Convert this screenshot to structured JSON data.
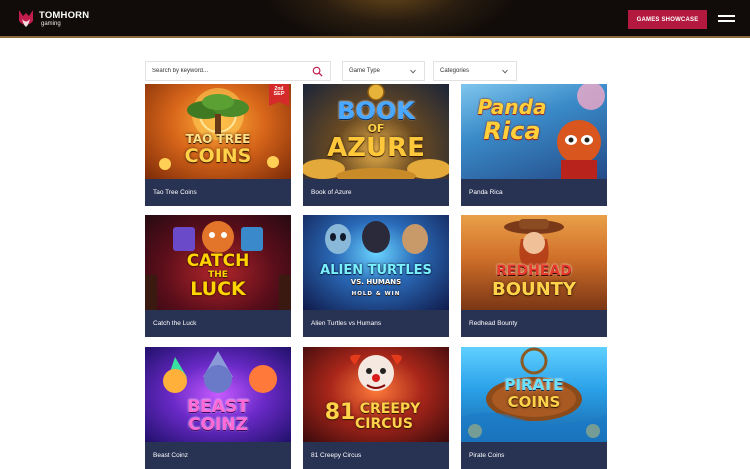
{
  "header": {
    "logo_title": "TOMHORN",
    "logo_sub": "gaming",
    "showcase_button": "GAMES SHOWCASE"
  },
  "filters": {
    "search_placeholder": "Search by keyword...",
    "game_type": "Game Type",
    "categories": "Categories"
  },
  "games": [
    {
      "name": "Tao Tree Coins",
      "art_line1": "TAO TREE",
      "art_line2": "COINS",
      "badge_day": "2nd",
      "badge_month": "SEP"
    },
    {
      "name": "Book of Azure",
      "art_line1": "BOOK",
      "art_line2": "OF",
      "art_line3": "AZURE"
    },
    {
      "name": "Panda Rica",
      "art_line1": "Panda",
      "art_line2": "Rica"
    },
    {
      "name": "Catch the Luck",
      "art_line1": "CATCH",
      "art_line2": "THE",
      "art_line3": "LUCK"
    },
    {
      "name": "Alien Turtles vs Humans",
      "art_line1": "ALIEN TURTLES",
      "art_line2": "VS. HUMANS",
      "art_line3": "HOLD & WIN"
    },
    {
      "name": "Redhead Bounty",
      "art_line1": "REDHEAD",
      "art_line2": "BOUNTY"
    },
    {
      "name": "Beast Coinz",
      "art_line1": "BEAST",
      "art_line2": "COINZ"
    },
    {
      "name": "81 Creepy Circus",
      "art_line1": "81",
      "art_line2": "CREEPY",
      "art_line3": "CIRCUS"
    },
    {
      "name": "Pirate Coins",
      "art_line1": "PIRATE",
      "art_line2": "COINS"
    }
  ],
  "colors": {
    "accent": "#b3183f",
    "caption_bg": "#283253",
    "header_bg": "#110c09"
  },
  "icons": {
    "logo": "tomhorn-logo-icon",
    "search": "search-icon",
    "menu": "hamburger-icon",
    "dropdown": "chevron-down-icon"
  }
}
